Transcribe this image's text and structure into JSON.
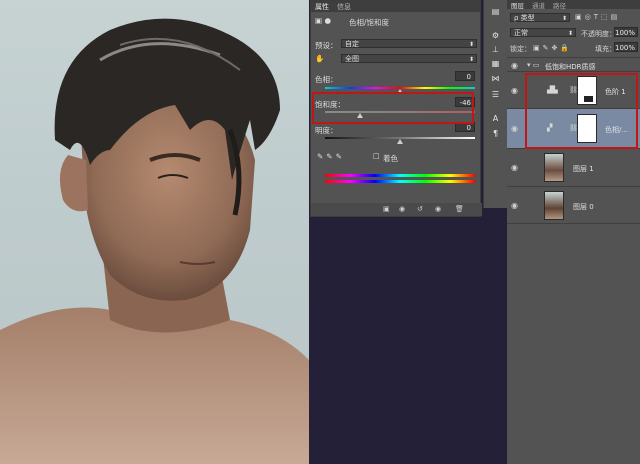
{
  "properties": {
    "tabs": [
      "属性",
      "信息"
    ],
    "panel_title": "色相/饱和度",
    "preset_label": "预设：",
    "preset_value": "自定",
    "channel_value": "全图",
    "hue_label": "色相：",
    "hue_value": "0",
    "saturation_label": "饱和度：",
    "saturation_value": "-46",
    "lightness_label": "明度：",
    "lightness_value": "0",
    "colorize_label": "着色"
  },
  "layers": {
    "tabs": [
      "图层",
      "通道",
      "路径"
    ],
    "filter_kind": "ρ 类型",
    "blend_mode": "正常",
    "opacity_label": "不透明度：",
    "opacity_value": "100%",
    "lock_label": "锁定：",
    "fill_label": "填充：",
    "fill_value": "100%",
    "group_name": "低饱和HDR质感",
    "items": [
      {
        "name": "色阶 1"
      },
      {
        "name": "色相/..."
      },
      {
        "name": "图层 1"
      },
      {
        "name": "图层 0"
      }
    ]
  },
  "colors": {
    "highlight_red": "#c01616",
    "panel_gray": "#535353",
    "canvas_bg": "#232037",
    "selected_row": "#7a8aa3"
  }
}
